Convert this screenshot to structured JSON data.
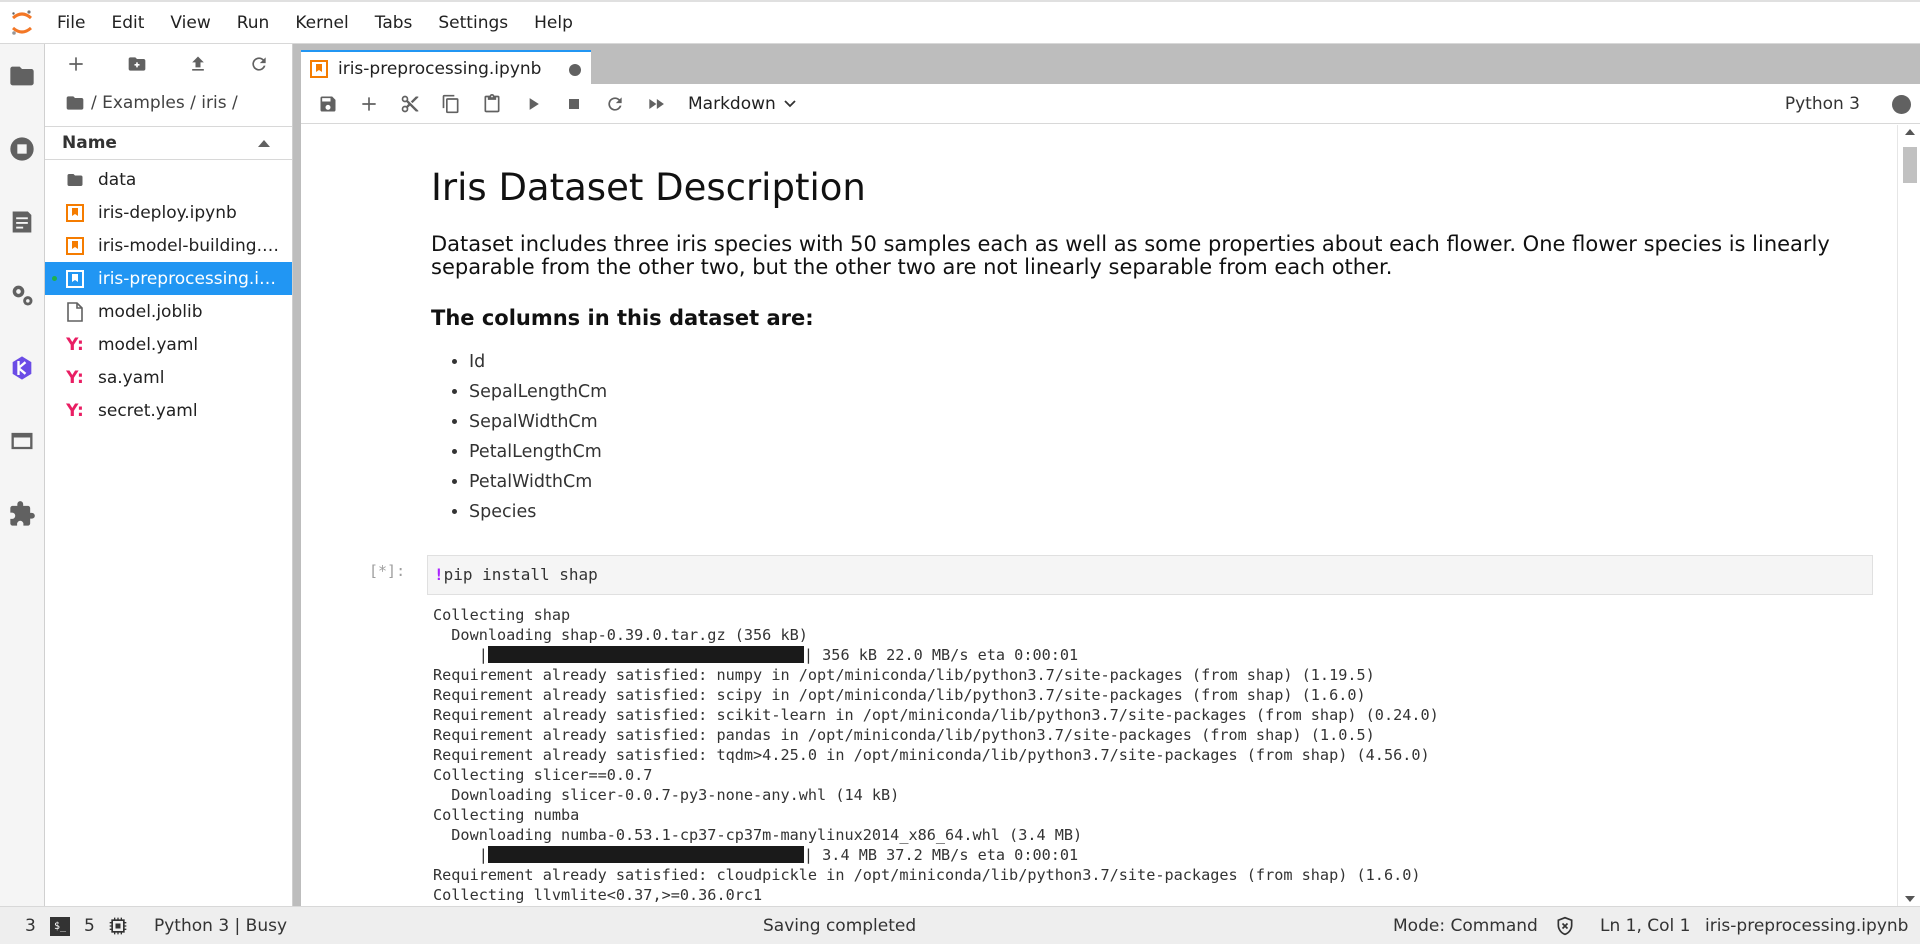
{
  "menubar": {
    "items": [
      "File",
      "Edit",
      "View",
      "Run",
      "Kernel",
      "Tabs",
      "Settings",
      "Help"
    ]
  },
  "activity_bar": {
    "icons": [
      "folder-icon",
      "running-icon",
      "commands-icon",
      "property-inspector-icon",
      "kubeflow-icon",
      "tabs-icon",
      "extension-icon"
    ]
  },
  "filebrowser": {
    "breadcrumb": "/ Examples / iris /",
    "header": "Name",
    "items": [
      {
        "name": "data",
        "type": "folder"
      },
      {
        "name": "iris-deploy.ipynb",
        "type": "notebook"
      },
      {
        "name": "iris-model-building.ipynb",
        "type": "notebook"
      },
      {
        "name": "iris-preprocessing.ipynb",
        "type": "notebook",
        "selected": true,
        "running": true
      },
      {
        "name": "model.joblib",
        "type": "file"
      },
      {
        "name": "model.yaml",
        "type": "yaml"
      },
      {
        "name": "sa.yaml",
        "type": "yaml"
      },
      {
        "name": "secret.yaml",
        "type": "yaml"
      }
    ]
  },
  "tab": {
    "title": "iris-preprocessing.ipynb"
  },
  "notebook_toolbar": {
    "cell_type": "Markdown",
    "kernel": "Python 3"
  },
  "markdown": {
    "title": "Iris Dataset Description",
    "description": "Dataset includes three iris species with 50 samples each as well as some properties about each flower. One flower species is linearly separable from the other two, but the other two are not linearly separable from each other.",
    "subtitle": "The columns in this dataset are:",
    "columns": [
      "Id",
      "SepalLengthCm",
      "SepalWidthCm",
      "PetalLengthCm",
      "PetalWidthCm",
      "Species"
    ]
  },
  "code_cell": {
    "prompt": "[*]:",
    "bang": "!",
    "source": "pip install shap",
    "output_lines": [
      "Collecting shap",
      "  Downloading shap-0.39.0.tar.gz (356 kB)",
      "     |",
      "| 356 kB 22.0 MB/s eta 0:00:01",
      "Requirement already satisfied: numpy in /opt/miniconda/lib/python3.7/site-packages (from shap) (1.19.5)",
      "Requirement already satisfied: scipy in /opt/miniconda/lib/python3.7/site-packages (from shap) (1.6.0)",
      "Requirement already satisfied: scikit-learn in /opt/miniconda/lib/python3.7/site-packages (from shap) (0.24.0)",
      "Requirement already satisfied: pandas in /opt/miniconda/lib/python3.7/site-packages (from shap) (1.0.5)",
      "Requirement already satisfied: tqdm>4.25.0 in /opt/miniconda/lib/python3.7/site-packages (from shap) (4.56.0)",
      "Collecting slicer==0.0.7",
      "  Downloading slicer-0.0.7-py3-none-any.whl (14 kB)",
      "Collecting numba",
      "  Downloading numba-0.53.1-cp37-cp37m-manylinux2014_x86_64.whl (3.4 MB)",
      "     |",
      "| 3.4 MB 37.2 MB/s eta 0:00:01",
      "Requirement already satisfied: cloudpickle in /opt/miniconda/lib/python3.7/site-packages (from shap) (1.6.0)",
      "Collecting llvmlite<0.37,>=0.36.0rc1"
    ],
    "progress": [
      1.0,
      1.0
    ]
  },
  "statusbar": {
    "terminals": "3",
    "kernels": "5",
    "kernel_status": "Python 3 | Busy",
    "message": "Saving completed",
    "mode": "Mode: Command",
    "position": "Ln 1, Col 1",
    "filename": "iris-preprocessing.ipynb"
  },
  "colors": {
    "accent": "#2196f3",
    "notebook_icon": "#f57c00",
    "yaml_icon": "#e91e63",
    "kubeflow": "#6b4ce6"
  }
}
